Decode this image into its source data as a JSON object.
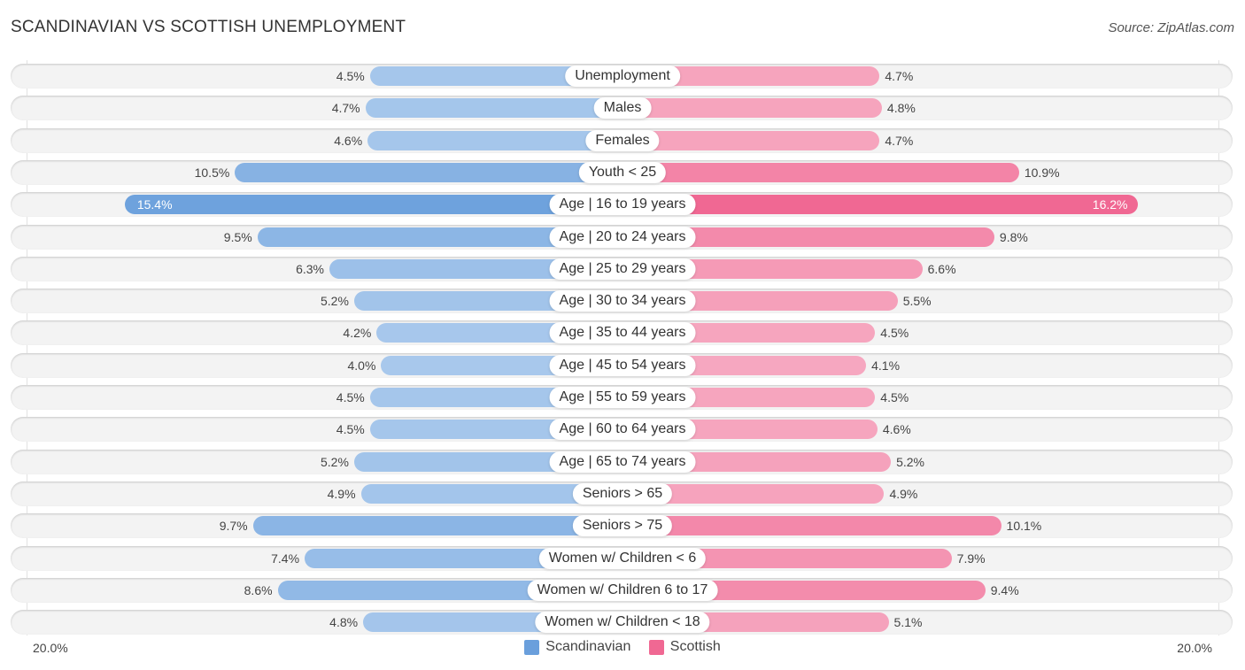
{
  "header": {
    "title": "SCANDINAVIAN VS SCOTTISH UNEMPLOYMENT",
    "source": "Source: ZipAtlas.com"
  },
  "chart_data": {
    "type": "bar",
    "orientation": "horizontal-diverging",
    "title": "SCANDINAVIAN VS SCOTTISH UNEMPLOYMENT",
    "xlabel": "",
    "ylabel": "",
    "xlim": [
      -20.0,
      20.0
    ],
    "axis_min_label": "20.0%",
    "axis_max_label": "20.0%",
    "legend_position": "bottom-center",
    "categories": [
      "Unemployment",
      "Males",
      "Females",
      "Youth < 25",
      "Age | 16 to 19 years",
      "Age | 20 to 24 years",
      "Age | 25 to 29 years",
      "Age | 30 to 34 years",
      "Age | 35 to 44 years",
      "Age | 45 to 54 years",
      "Age | 55 to 59 years",
      "Age | 60 to 64 years",
      "Age | 65 to 74 years",
      "Seniors > 65",
      "Seniors > 75",
      "Women w/ Children < 6",
      "Women w/ Children 6 to 17",
      "Women w/ Children < 18"
    ],
    "series": [
      {
        "name": "Scandinavian",
        "color": "#6a9fdc",
        "values": [
          4.5,
          4.7,
          4.6,
          10.5,
          15.4,
          9.5,
          6.3,
          5.2,
          4.2,
          4.0,
          4.5,
          4.5,
          5.2,
          4.9,
          9.7,
          7.4,
          8.6,
          4.8
        ]
      },
      {
        "name": "Scottish",
        "color": "#f06893",
        "values": [
          4.7,
          4.8,
          4.7,
          10.9,
          16.2,
          9.8,
          6.6,
          5.5,
          4.5,
          4.1,
          4.5,
          4.6,
          5.2,
          4.9,
          10.1,
          7.9,
          9.4,
          5.1
        ]
      }
    ]
  }
}
